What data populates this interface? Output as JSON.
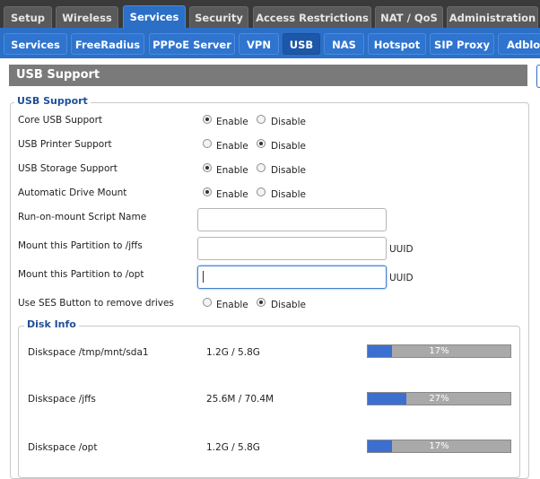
{
  "main_tabs": [
    "Setup",
    "Wireless",
    "Services",
    "Security",
    "Access Restrictions",
    "NAT / QoS",
    "Administration"
  ],
  "sub_tabs": [
    "Services",
    "FreeRadius",
    "PPPoE Server",
    "VPN",
    "USB",
    "NAS",
    "Hotspot",
    "SIP Proxy",
    "Adbloc"
  ],
  "page_title": "USB Support",
  "section_title": "USB Support",
  "options": {
    "enable_label": "Enable",
    "disable_label": "Disable",
    "core_usb": {
      "label": "Core USB Support",
      "value": "Enable"
    },
    "usb_printer": {
      "label": "USB Printer Support",
      "value": "Disable"
    },
    "usb_storage": {
      "label": "USB Storage Support",
      "value": "Enable"
    },
    "auto_mount": {
      "label": "Automatic Drive Mount",
      "value": "Enable"
    },
    "ses_button": {
      "label": "Use SES Button to remove drives",
      "value": "Disable"
    }
  },
  "fields": {
    "script_name": {
      "label": "Run-on-mount Script Name",
      "value": ""
    },
    "mount_jffs": {
      "label": "Mount this Partition to /jffs",
      "value": "",
      "suffix": "UUID"
    },
    "mount_opt": {
      "label": "Mount this Partition to /opt",
      "value": "",
      "suffix": "UUID"
    }
  },
  "disk_info": {
    "title": "Disk Info",
    "disks": [
      {
        "label": "Diskspace /tmp/mnt/sda1",
        "size": "1.2G / 5.8G",
        "percent_text": "17%",
        "percent": 17
      },
      {
        "label": "Diskspace /jffs",
        "size": "25.6M / 70.4M",
        "percent_text": "27%",
        "percent": 27
      },
      {
        "label": "Diskspace /opt",
        "size": "1.2G / 5.8G",
        "percent_text": "17%",
        "percent": 17
      }
    ]
  },
  "colors": {
    "accent": "#2b6fc6",
    "bar_fill": "#3c6fcf",
    "bar_bg": "#a9a9a9"
  }
}
